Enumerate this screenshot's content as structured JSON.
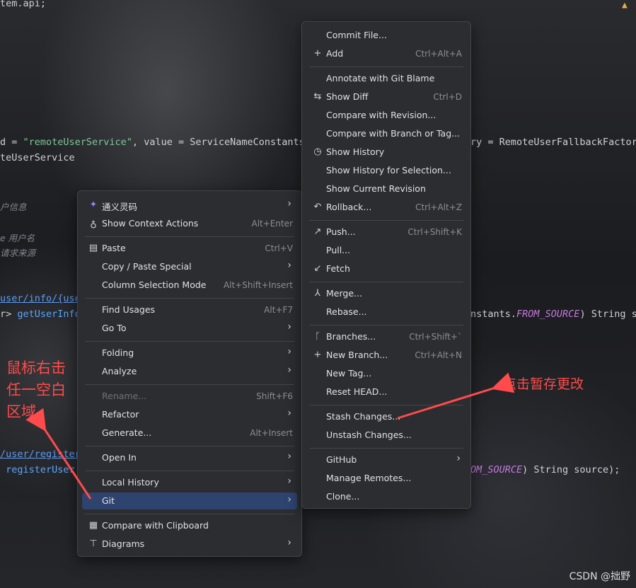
{
  "editor": {
    "lines": [
      {
        "segments": [
          {
            "t": "tem.api;",
            "c": ""
          }
        ]
      },
      {
        "segments": [
          {
            "t": "d = ",
            "c": ""
          },
          {
            "t": "\"remoteUserService\"",
            "c": "str"
          },
          {
            "t": ", value = ServiceNameConstants",
            "c": ""
          }
        ]
      },
      {
        "segments": [
          {
            "t": "teUserService",
            "c": ""
          }
        ]
      },
      {
        "segments": [
          {
            "t": "户信息",
            "c": "cmt"
          }
        ]
      },
      {
        "segments": [
          {
            "t": "e ",
            "c": "cmt"
          },
          {
            "t": "用户名",
            "c": "cmt"
          }
        ]
      },
      {
        "segments": [
          {
            "t": "请求来源",
            "c": "cmt"
          }
        ]
      },
      {
        "segments": [
          {
            "t": "user/info/{user",
            "c": "link"
          }
        ]
      },
      {
        "segments": [
          {
            "t": "r> ",
            "c": ""
          },
          {
            "t": "getUserInfo",
            "c": "fn"
          }
        ]
      },
      {
        "segments": [
          {
            "t": "/user/register",
            "c": "link"
          }
        ]
      },
      {
        "segments": [
          {
            "t": " registerUser",
            "c": "fn"
          }
        ]
      }
    ],
    "right_lines": [
      {
        "segments": [
          {
            "t": "ry = RemoteUserFallbackFactory",
            "c": ""
          }
        ]
      },
      {
        "segments": [
          {
            "t": "nstants.",
            "c": ""
          },
          {
            "t": "FROM_SOURCE",
            "c": "const"
          },
          {
            "t": ") String so",
            "c": ""
          }
        ]
      },
      {
        "segments": [
          {
            "t": "OM_SOURCE",
            "c": "const"
          },
          {
            "t": ") String source);",
            "c": ""
          }
        ]
      }
    ],
    "warning_icon": "warning-icon"
  },
  "context_menu": {
    "items": [
      {
        "label": "通义灵码",
        "icon": "tongyi-icon",
        "submenu": true
      },
      {
        "label": "Show Context Actions",
        "icon": "bulb-icon",
        "shortcut": "Alt+Enter"
      },
      {
        "label": "Paste",
        "icon": "clipboard-icon",
        "shortcut": "Ctrl+V"
      },
      {
        "label": "Copy / Paste Special",
        "submenu": true
      },
      {
        "label": "Column Selection Mode",
        "shortcut": "Alt+Shift+Insert"
      },
      {
        "label": "Find Usages",
        "shortcut": "Alt+F7"
      },
      {
        "label": "Go To",
        "submenu": true
      },
      {
        "label": "Folding",
        "submenu": true
      },
      {
        "label": "Analyze",
        "submenu": true
      },
      {
        "label": "Rename...",
        "shortcut": "Shift+F6",
        "disabled": true
      },
      {
        "label": "Refactor",
        "submenu": true
      },
      {
        "label": "Generate...",
        "shortcut": "Alt+Insert"
      },
      {
        "label": "Open In",
        "submenu": true
      },
      {
        "label": "Local History",
        "submenu": true
      },
      {
        "label": "Git",
        "submenu": true,
        "active": true
      },
      {
        "label": "Compare with Clipboard",
        "icon": "compare-icon"
      },
      {
        "label": "Diagrams",
        "icon": "diagram-icon",
        "submenu": true
      }
    ]
  },
  "git_menu": {
    "items": [
      {
        "label": "Commit File..."
      },
      {
        "label": "Add",
        "icon": "plus-icon",
        "shortcut": "Ctrl+Alt+A"
      },
      {
        "label": "Annotate with Git Blame"
      },
      {
        "label": "Show Diff",
        "icon": "diff-icon",
        "shortcut": "Ctrl+D"
      },
      {
        "label": "Compare with Revision..."
      },
      {
        "label": "Compare with Branch or Tag..."
      },
      {
        "label": "Show History",
        "icon": "clock-icon"
      },
      {
        "label": "Show History for Selection..."
      },
      {
        "label": "Show Current Revision"
      },
      {
        "label": "Rollback...",
        "icon": "undo-icon",
        "shortcut": "Ctrl+Alt+Z"
      },
      {
        "label": "Push...",
        "icon": "push-arrow-icon",
        "shortcut": "Ctrl+Shift+K"
      },
      {
        "label": "Pull..."
      },
      {
        "label": "Fetch",
        "icon": "fetch-arrow-icon"
      },
      {
        "label": "Merge...",
        "icon": "merge-icon"
      },
      {
        "label": "Rebase..."
      },
      {
        "label": "Branches...",
        "icon": "branch-icon",
        "shortcut": "Ctrl+Shift+`"
      },
      {
        "label": "New Branch...",
        "icon": "plus-icon",
        "shortcut": "Ctrl+Alt+N"
      },
      {
        "label": "New Tag..."
      },
      {
        "label": "Reset HEAD..."
      },
      {
        "label": "Stash Changes..."
      },
      {
        "label": "Unstash Changes..."
      },
      {
        "label": "GitHub",
        "submenu": true
      },
      {
        "label": "Manage Remotes..."
      },
      {
        "label": "Clone..."
      }
    ]
  },
  "annotations": {
    "left_note": [
      "鼠标右击",
      "任一空白",
      "区域"
    ],
    "right_note": "点击暂存更改",
    "color": "#ff4b4b"
  },
  "watermark": "CSDN @拙野"
}
